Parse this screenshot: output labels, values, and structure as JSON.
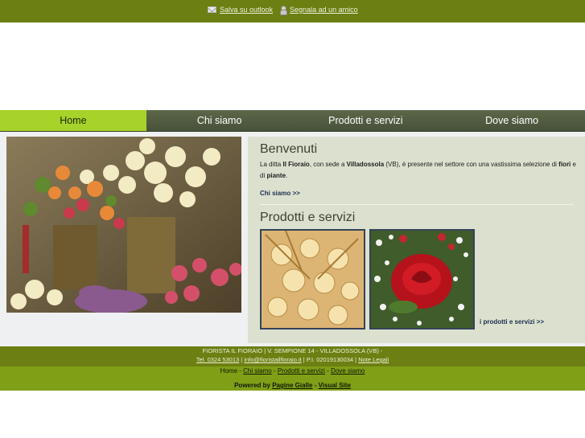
{
  "topbar": {
    "save_outlook": "Salva su outlook",
    "tell_friend": "Segnala ad un amico"
  },
  "nav": {
    "items": [
      {
        "label": "Home",
        "active": true
      },
      {
        "label": "Chi siamo"
      },
      {
        "label": "Prodotti e servizi"
      },
      {
        "label": "Dove siamo"
      }
    ]
  },
  "welcome": {
    "title": "Benvenuti",
    "t1": "La ditta ",
    "b1": "Il Fioraio",
    "t2": ", con sede a ",
    "b2": "Villadossola",
    "t3": " (VB), è presente nel settore con una vastissima selezione di ",
    "b3": "fiori",
    "t4": " e di ",
    "b4": "piante",
    "t5": ".",
    "link": "Chi siamo >>"
  },
  "products": {
    "title": "Prodotti e servizi",
    "link": "i prodotti e servizi >>"
  },
  "footer": {
    "address": "FIORISTA IL FIORAIO | V. SEMPIONE 14 - VILLADOSSOLA (VB) -",
    "tel": "Tel. 0324 53013",
    "sep1": " | ",
    "email": "info@fioristailfioraio.it",
    "piva": " | P.I. 02019130034 | ",
    "legal": "Note Legali",
    "nav_home": "Home",
    "nav_sep": " - ",
    "nav_chi": "Chi siamo",
    "nav_prod": "Prodotti e servizi",
    "nav_dove": "Dove siamo",
    "powered_label": "Powered by ",
    "pagine_gialle": "Pagine Gialle",
    "dash": " - ",
    "visual_site": "Visual Site"
  },
  "colors": {
    "topbar": "#6b7f12",
    "nav_active": "#a6d22a",
    "nav_bg": "#525c41",
    "panel": "#dce0cf",
    "footer_dark": "#6c7f12",
    "footer_light": "#7f9f17"
  }
}
